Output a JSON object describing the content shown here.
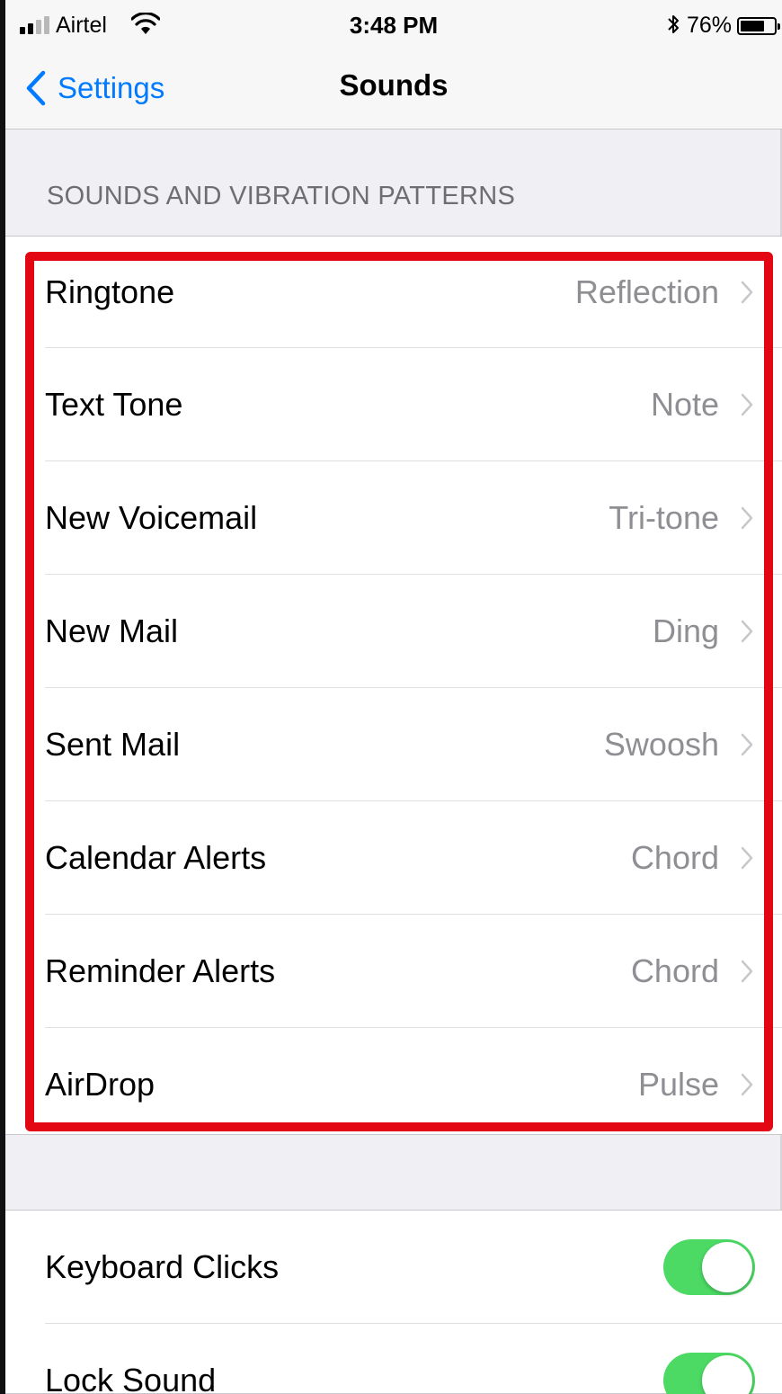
{
  "status_bar": {
    "carrier": "Airtel",
    "time": "3:48 PM",
    "battery_percent": "76%",
    "battery_level": 0.76,
    "icons": [
      "signal-icon",
      "wifi-icon",
      "bluetooth-icon",
      "battery-icon"
    ]
  },
  "nav": {
    "back_label": "Settings",
    "title": "Sounds"
  },
  "section": {
    "header": "SOUNDS AND VIBRATION PATTERNS"
  },
  "sounds": [
    {
      "label": "Ringtone",
      "value": "Reflection"
    },
    {
      "label": "Text Tone",
      "value": "Note"
    },
    {
      "label": "New Voicemail",
      "value": "Tri-tone"
    },
    {
      "label": "New Mail",
      "value": "Ding"
    },
    {
      "label": "Sent Mail",
      "value": "Swoosh"
    },
    {
      "label": "Calendar Alerts",
      "value": "Chord"
    },
    {
      "label": "Reminder Alerts",
      "value": "Chord"
    },
    {
      "label": "AirDrop",
      "value": "Pulse"
    }
  ],
  "toggles": [
    {
      "label": "Keyboard Clicks",
      "on": true
    },
    {
      "label": "Lock Sound",
      "on": true
    }
  ],
  "colors": {
    "accent": "#007aff",
    "toggle_on": "#4cd964",
    "highlight": "#e30613",
    "background": "#efeff4",
    "secondary_text": "#8e8e93"
  }
}
